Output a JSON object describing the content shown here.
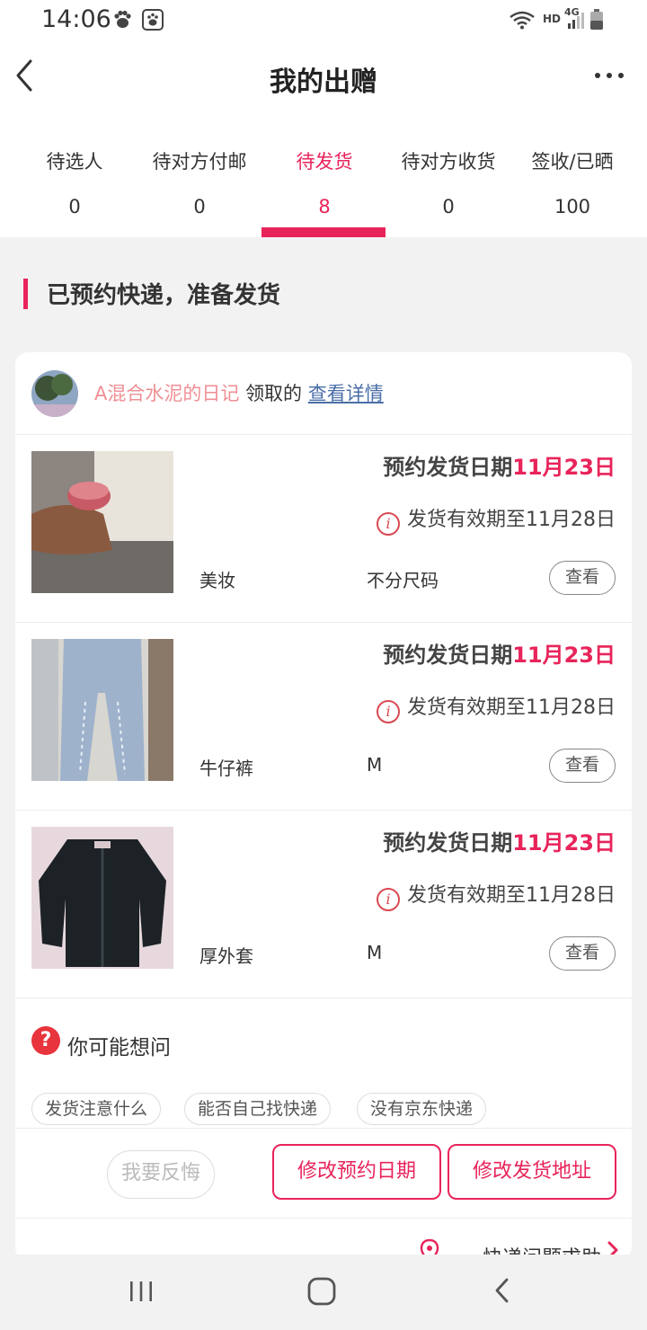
{
  "status_bar": {
    "time": "14:06",
    "network_label": "HD",
    "signal_label": "4G"
  },
  "header": {
    "title": "我的出赠"
  },
  "tabs": [
    {
      "label": "待选人",
      "count": "0"
    },
    {
      "label": "待对方付邮",
      "count": "0"
    },
    {
      "label": "待发货",
      "count": "8",
      "active": true
    },
    {
      "label": "待对方收货",
      "count": "0"
    },
    {
      "label": "签收/已晒",
      "count": "100"
    }
  ],
  "section": {
    "title": "已预约快递，准备发货"
  },
  "claimer": {
    "name": "A混合水泥的日记",
    "middle": "领取的",
    "link": "查看详情"
  },
  "items": [
    {
      "date_prefix": "预约发货日期",
      "date": "11月23日",
      "expiry": "发货有效期至11月28日",
      "category": "美妆",
      "size": "不分尺码",
      "view_label": "查看"
    },
    {
      "date_prefix": "预约发货日期",
      "date": "11月23日",
      "expiry": "发货有效期至11月28日",
      "category": "牛仔裤",
      "size": "M",
      "view_label": "查看"
    },
    {
      "date_prefix": "预约发货日期",
      "date": "11月23日",
      "expiry": "发货有效期至11月28日",
      "category": "厚外套",
      "size": "M",
      "view_label": "查看"
    }
  ],
  "faq": {
    "title": "你可能想问",
    "chips": [
      "发货注意什么",
      "能否自己找快递",
      "没有京东快递"
    ]
  },
  "actions": {
    "regret": "我要反悔",
    "change_date": "修改预约日期",
    "change_address": "修改发货地址"
  },
  "help": {
    "label": "快递问题求助"
  },
  "colors": {
    "accent": "#e8245a",
    "claimer_name": "#ef8f95",
    "link": "#4a6ea8",
    "faq_icon": "#e8343c"
  },
  "icons": {
    "back": "back-arrow-icon",
    "more": "more-dots-icon",
    "info": "info-circle-icon",
    "faq": "question-circle-icon",
    "help": "location-pin-icon"
  }
}
